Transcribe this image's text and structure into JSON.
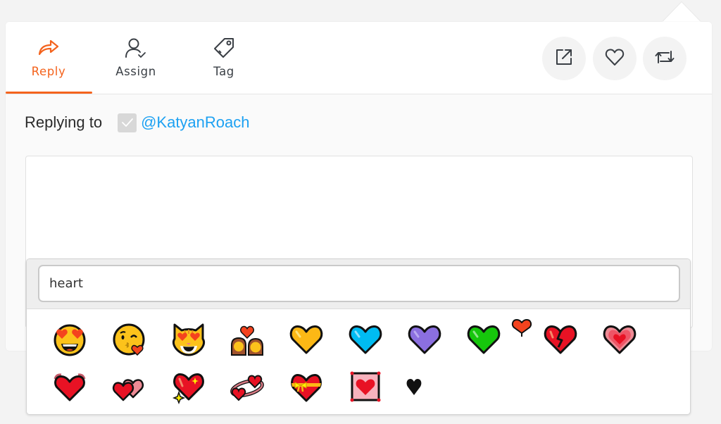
{
  "tabs": [
    {
      "id": "reply",
      "label": "Reply",
      "icon": "reply-arrow-icon",
      "active": true
    },
    {
      "id": "assign",
      "label": "Assign",
      "icon": "assign-user-icon",
      "active": false
    },
    {
      "id": "tag",
      "label": "Tag",
      "icon": "tag-icon",
      "active": false
    }
  ],
  "actions": [
    {
      "id": "open-external",
      "icon": "external-link-icon"
    },
    {
      "id": "like",
      "icon": "heart-outline-icon"
    },
    {
      "id": "retweet",
      "icon": "retweet-icon"
    }
  ],
  "reply_to": {
    "label": "Replying to",
    "checked": true,
    "handle": "@KatyanRoach"
  },
  "composer": {
    "value": ""
  },
  "emoji_picker": {
    "search_value": "heart",
    "results": [
      {
        "name": "smiling face with heart-eyes",
        "icon": "heart-eyes-face-icon"
      },
      {
        "name": "face blowing a kiss",
        "icon": "kiss-face-icon"
      },
      {
        "name": "smiling cat with heart-eyes",
        "icon": "heart-eyes-cat-icon"
      },
      {
        "name": "couple with heart",
        "icon": "couple-heart-icon"
      },
      {
        "name": "yellow heart",
        "icon": "yellow-heart-icon"
      },
      {
        "name": "blue heart",
        "icon": "blue-heart-icon"
      },
      {
        "name": "purple heart",
        "icon": "purple-heart-icon"
      },
      {
        "name": "green heart",
        "icon": "green-heart-icon"
      },
      {
        "name": "heart exclamation",
        "icon": "heart-exclamation-icon"
      },
      {
        "name": "broken heart",
        "icon": "broken-heart-icon"
      },
      {
        "name": "growing heart",
        "icon": "growing-heart-icon"
      },
      {
        "name": "beating heart",
        "icon": "beating-heart-icon"
      },
      {
        "name": "two hearts",
        "icon": "two-hearts-icon"
      },
      {
        "name": "sparkling heart",
        "icon": "sparkling-heart-icon"
      },
      {
        "name": "revolving hearts",
        "icon": "revolving-hearts-icon"
      },
      {
        "name": "heart with ribbon",
        "icon": "heart-ribbon-icon"
      },
      {
        "name": "heart decoration",
        "icon": "heart-decoration-icon"
      },
      {
        "name": "black heart suit",
        "icon": "heart-suit-icon"
      }
    ]
  },
  "colors": {
    "accent": "#f4631d",
    "link": "#1da1f2",
    "text": "#3a3f45",
    "page_bg": "#f3f3f3"
  }
}
